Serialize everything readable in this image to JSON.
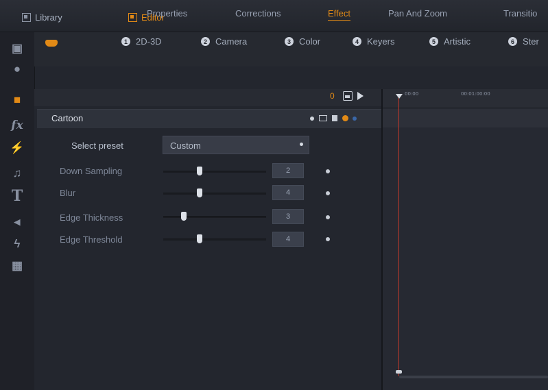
{
  "top_tabs": {
    "library": "Library",
    "editor": "Editor"
  },
  "sub_tabs": [
    "Properties",
    "Corrections",
    "Effect",
    "Pan And Zoom",
    "Transitio"
  ],
  "active_sub_tab": "Effect",
  "categories": [
    {
      "num": "1",
      "label": "2D-3D"
    },
    {
      "num": "2",
      "label": "Camera"
    },
    {
      "num": "3",
      "label": "Color"
    },
    {
      "num": "4",
      "label": "Keyers"
    },
    {
      "num": "5",
      "label": "Artistic"
    },
    {
      "num": "6",
      "label": "Ster"
    }
  ],
  "controls": {
    "counter": "0"
  },
  "effect_panel": {
    "title": "Cartoon",
    "preset_label": "Select preset",
    "preset_value": "Custom",
    "params": [
      {
        "label": "Down Sampling",
        "value": "2",
        "level": 0.35
      },
      {
        "label": "Blur",
        "value": "4",
        "level": 0.35
      },
      {
        "label": "Edge Thickness",
        "value": "3",
        "level": 0.2
      },
      {
        "label": "Edge Threshold",
        "value": "4",
        "level": 0.35
      }
    ]
  },
  "timeline": {
    "ruler_labels": [
      "00:00",
      "00:01:00:00"
    ]
  },
  "colors": {
    "accent": "#e28a16",
    "playhead": "#c0392b",
    "background": "#23262e"
  },
  "icons": [
    "library-icon",
    "editor-icon",
    "theme-icon",
    "montage-icon",
    "effect-icon",
    "fx-icon",
    "transition-icon",
    "music-icon",
    "title-icon",
    "sound-icon",
    "motion-icon",
    "disc-menu-icon"
  ]
}
